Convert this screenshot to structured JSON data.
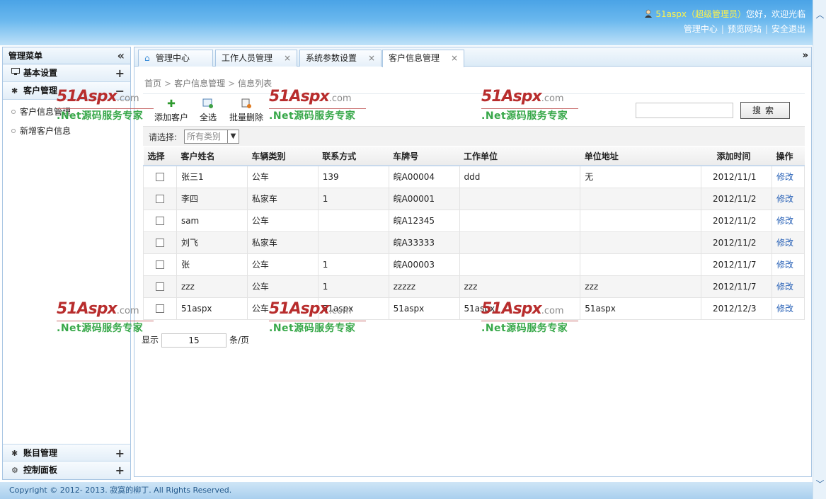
{
  "header": {
    "username": "51aspx",
    "role": "（超级管理员）",
    "welcome": "您好，欢迎光临",
    "links": [
      "管理中心",
      "预览网站",
      "安全退出"
    ]
  },
  "sidebar": {
    "title": "管理菜单",
    "groups": {
      "basic": "基本设置",
      "customer": "客户管理",
      "account": "账目管理",
      "control": "控制面板"
    },
    "items": [
      "客户信息管理",
      "新增客户信息"
    ]
  },
  "tabs": [
    {
      "label": "管理中心"
    },
    {
      "label": "工作人员管理"
    },
    {
      "label": "系统参数设置"
    },
    {
      "label": "客户信息管理"
    }
  ],
  "breadcrumb": [
    "首页",
    "客户信息管理",
    "信息列表"
  ],
  "toolbar": {
    "add_label": "添加客户",
    "select_all_label": "全选",
    "batch_delete_label": "批量删除",
    "search_value": "",
    "search_label": "搜索"
  },
  "filter": {
    "label": "请选择:",
    "selected": "所有类别"
  },
  "table": {
    "headers": [
      "选择",
      "客户姓名",
      "车辆类别",
      "联系方式",
      "车牌号",
      "工作单位",
      "单位地址",
      "添加时间",
      "操作"
    ],
    "rows": [
      [
        "张三1",
        "公车",
        "139",
        "皖A00004",
        "ddd",
        "无",
        "2012/11/1",
        "修改"
      ],
      [
        "李四",
        "私家车",
        "1",
        "皖A00001",
        "",
        "",
        "2012/11/2",
        "修改"
      ],
      [
        "sam",
        "公车",
        "",
        "皖A12345",
        "",
        "",
        "2012/11/2",
        "修改"
      ],
      [
        "刘飞",
        "私家车",
        "",
        "皖A33333",
        "",
        "",
        "2012/11/2",
        "修改"
      ],
      [
        "张",
        "公车",
        "1",
        "皖A00003",
        "",
        "",
        "2012/11/7",
        "修改"
      ],
      [
        "zzz",
        "公车",
        "1",
        "zzzzz",
        "zzz",
        "zzz",
        "2012/11/7",
        "修改"
      ],
      [
        "51aspx",
        "公车",
        "51aspx",
        "51aspx",
        "51aspx",
        "51aspx",
        "2012/12/3",
        "修改"
      ]
    ]
  },
  "pager": {
    "prefix": "显示",
    "page_size": "15",
    "suffix": "条/页"
  },
  "footer": {
    "copyright": "Copyright © 2012- 2013. 寂寞的柳丁. All Rights Reserved."
  },
  "watermark": {
    "logo": "51Aspx",
    "domain": ".com",
    "slogan": ".Net源码服务专家"
  },
  "colors": {
    "header_top": "#4aa3e6",
    "link": "#2861b7",
    "watermark_red": "#b82d2d",
    "watermark_green": "#38a84a"
  }
}
